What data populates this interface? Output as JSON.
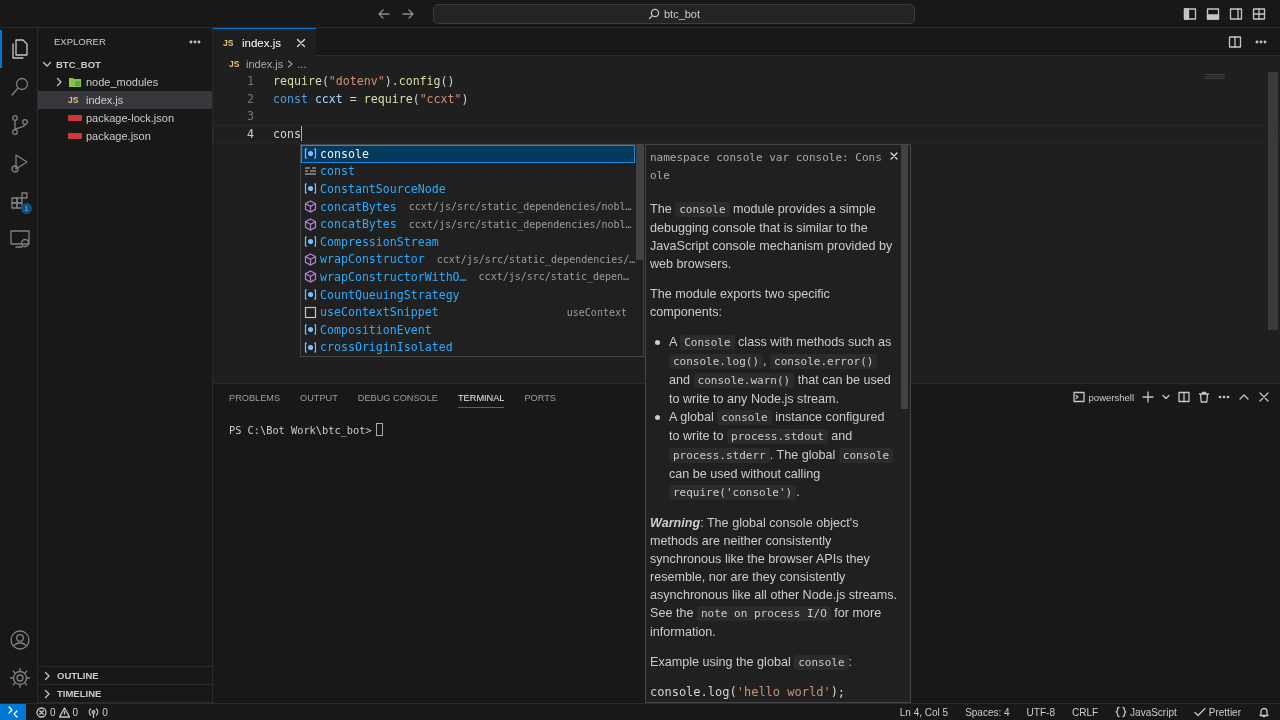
{
  "title_bar": {
    "search": "btc_bot"
  },
  "activity_bar": {
    "items": [
      {
        "kind": "explorer",
        "selected": true
      },
      {
        "kind": "search",
        "selected": false
      },
      {
        "kind": "source-control",
        "selected": false
      },
      {
        "kind": "run",
        "selected": false
      },
      {
        "kind": "extensions",
        "selected": false,
        "badge": "1"
      },
      {
        "kind": "remote",
        "selected": false
      }
    ],
    "bottom": [
      {
        "kind": "account"
      },
      {
        "kind": "manage"
      }
    ]
  },
  "sidebar": {
    "title": "EXPLORER",
    "root": {
      "label": "BTC_BOT",
      "expanded": true,
      "children": [
        {
          "label": "node_modules",
          "kind": "folder",
          "expanded": false,
          "selected": false
        },
        {
          "label": "index.js",
          "kind": "js",
          "icon_text": "JS",
          "selected": true
        },
        {
          "label": "package-lock.json",
          "kind": "json",
          "selected": false
        },
        {
          "label": "package.json",
          "kind": "json",
          "selected": false
        }
      ]
    },
    "sections": [
      {
        "label": "OUTLINE",
        "expanded": false
      },
      {
        "label": "TIMELINE",
        "expanded": false
      }
    ]
  },
  "editor": {
    "tabs": [
      {
        "label": "index.js",
        "kind": "js",
        "icon_text": "JS",
        "selected": true
      }
    ],
    "breadcrumb": {
      "icon_text": "JS",
      "items": [
        "index.js",
        "..."
      ]
    },
    "lines": [
      {
        "number": "1",
        "tokens": [
          {
            "t": "require",
            "kind": "function"
          },
          {
            "t": "(",
            "kind": "punctuation"
          },
          {
            "t": "\"dotenv\"",
            "kind": "string"
          },
          {
            "t": ").",
            "kind": "punctuation"
          },
          {
            "t": "config",
            "kind": "function"
          },
          {
            "t": "()",
            "kind": "punctuation"
          }
        ],
        "current": false
      },
      {
        "number": "2",
        "tokens": [
          {
            "t": "const ",
            "kind": "keyword"
          },
          {
            "t": "ccxt",
            "kind": "variable"
          },
          {
            "t": " = ",
            "kind": "punctuation"
          },
          {
            "t": "require",
            "kind": "function"
          },
          {
            "t": "(",
            "kind": "punctuation"
          },
          {
            "t": "\"ccxt\"",
            "kind": "string"
          },
          {
            "t": ")",
            "kind": "punctuation"
          }
        ],
        "current": false
      },
      {
        "number": "3",
        "current": false
      },
      {
        "number": "4",
        "tokens": [
          {
            "t": "cons",
            "kind": "punctuation"
          }
        ],
        "current": true
      }
    ],
    "suggestions": [
      {
        "kind": "variable",
        "selected": true,
        "label": "console"
      },
      {
        "kind": "keyword",
        "selected": false,
        "label": "const"
      },
      {
        "kind": "variable",
        "selected": false,
        "label": "ConstantSourceNode"
      },
      {
        "kind": "method",
        "selected": false,
        "label": "concatBytes",
        "detail": "ccxt/js/src/static_dependencies/nobl…"
      },
      {
        "kind": "method",
        "selected": false,
        "label": "concatBytes",
        "detail": "ccxt/js/src/static_dependencies/nobl…"
      },
      {
        "kind": "variable",
        "selected": false,
        "label": "CompressionStream"
      },
      {
        "kind": "method",
        "selected": false,
        "label": "wrapConstructor",
        "detail": "ccxt/js/src/static_dependencies/…"
      },
      {
        "kind": "method",
        "selected": false,
        "label": "wrapConstructorWithO…",
        "detail": "ccxt/js/src/static_depen…"
      },
      {
        "kind": "variable",
        "selected": false,
        "label": "CountQueuingStrategy"
      },
      {
        "kind": "snippet",
        "selected": false,
        "label": "useContextSnippet",
        "detail": "useContext"
      },
      {
        "kind": "variable",
        "selected": false,
        "label": "CompositionEvent"
      },
      {
        "kind": "variable",
        "selected": false,
        "label": "crossOriginIsolated"
      }
    ],
    "docs": {
      "signature": "namespace console var console: Console",
      "blocks": [
        {
          "kind": "paragraph",
          "segments": [
            {
              "kind": "text",
              "t": "The "
            },
            {
              "kind": "code",
              "t": "console"
            },
            {
              "kind": "text",
              "t": " module provides a simple debugging console that is similar to the JavaScript console mechanism provided by web browsers."
            }
          ]
        },
        {
          "kind": "paragraph",
          "segments": [
            {
              "kind": "text",
              "t": "The module exports two specific components:"
            }
          ]
        },
        {
          "kind": "list",
          "items": [
            [
              {
                "kind": "text",
                "t": "A "
              },
              {
                "kind": "code",
                "t": "Console"
              },
              {
                "kind": "text",
                "t": " class with methods such as "
              },
              {
                "kind": "code",
                "t": "console.log()"
              },
              {
                "kind": "text",
                "t": ", "
              },
              {
                "kind": "code",
                "t": "console.error()"
              },
              {
                "kind": "text",
                "t": " and "
              },
              {
                "kind": "code",
                "t": "console.warn()"
              },
              {
                "kind": "text",
                "t": " that can be used to write to any Node.js stream."
              }
            ],
            [
              {
                "kind": "text",
                "t": "A global "
              },
              {
                "kind": "code",
                "t": "console"
              },
              {
                "kind": "text",
                "t": " instance configured to write to "
              },
              {
                "kind": "code",
                "t": "process.stdout"
              },
              {
                "kind": "text",
                "t": " and "
              },
              {
                "kind": "code",
                "t": "process.stderr"
              },
              {
                "kind": "text",
                "t": ". The global "
              },
              {
                "kind": "code",
                "t": "console"
              },
              {
                "kind": "text",
                "t": " can be used without calling "
              },
              {
                "kind": "code",
                "t": "require('console')"
              },
              {
                "kind": "text",
                "t": "."
              }
            ]
          ]
        },
        {
          "kind": "paragraph",
          "segments": [
            {
              "kind": "emphasis",
              "t": "Warning"
            },
            {
              "kind": "text",
              "t": ": The global console object's methods are neither consistently synchronous like the browser APIs they resemble, nor are they consistently asynchronous like all other Node.js streams. See the "
            },
            {
              "kind": "code",
              "t": "note on process I/O"
            },
            {
              "kind": "text",
              "t": " for more information."
            }
          ]
        },
        {
          "kind": "paragraph",
          "segments": [
            {
              "kind": "text",
              "t": "Example using the global "
            },
            {
              "kind": "code",
              "t": "console"
            },
            {
              "kind": "text",
              "t": ":"
            }
          ]
        },
        {
          "kind": "code",
          "segments": [
            {
              "kind": "text",
              "t": "console.log("
            },
            {
              "kind": "string",
              "t": "'hello world'"
            },
            {
              "kind": "text",
              "t": ");"
            }
          ]
        }
      ]
    }
  },
  "panel": {
    "tabs": [
      {
        "label": "PROBLEMS",
        "selected": false
      },
      {
        "label": "OUTPUT",
        "selected": false
      },
      {
        "label": "DEBUG CONSOLE",
        "selected": false
      },
      {
        "label": "TERMINAL",
        "selected": true
      },
      {
        "label": "PORTS",
        "selected": false
      }
    ],
    "shell": "powershell",
    "prompt": "PS C:\\Bot Work\\btc_bot>"
  },
  "status_bar": {
    "errors": "0",
    "warnings": "0",
    "ports": "0",
    "right": [
      {
        "kind": "text",
        "label": "Ln 4, Col 5"
      },
      {
        "kind": "text",
        "label": "Spaces: 4"
      },
      {
        "kind": "text",
        "label": "UTF-8"
      },
      {
        "kind": "text",
        "label": "CRLF"
      },
      {
        "kind": "language",
        "label": "JavaScript"
      },
      {
        "kind": "check",
        "label": "Prettier"
      },
      {
        "kind": "bell"
      }
    ]
  }
}
